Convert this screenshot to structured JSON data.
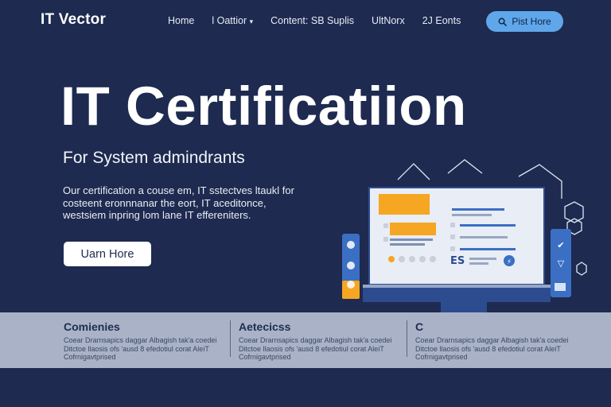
{
  "nav": {
    "brand": "IT Vector",
    "links": [
      "Home",
      "l Oattior",
      "Content: SB Suplis",
      "UltNorx",
      "2J Eonts"
    ],
    "cta_label": "Pist Hore",
    "cta_icon": "search-icon"
  },
  "hero": {
    "title": "IT Certificatiion",
    "subtitle": "For System admindrants",
    "description": "Our certification a couse em, IT sstectves ltaukl for costeent eronnnanar the eort, IT aceditonce, westsiem inpring lom lane IT effereniters.",
    "cta_label": "Uarn Hore"
  },
  "illustration": {
    "screen_label": "ES"
  },
  "columns": [
    {
      "title": "Comienies",
      "body": "Coear Drarnsapics daggar Albagish tak'a coedei Ditctoe llaosis ofs 'ausd 8 efedotiul corat AleiT Cofrnigavtprised"
    },
    {
      "title": "Aetecicss",
      "body": "Coear Drarnsapics daggar Albagish tak'a coedei Ditctoe llaosis ofs 'ausd 8 efedotiul corat AleiT Cofrnigavtprised"
    },
    {
      "title": "C",
      "body": "Coear Drarnsapics daggar Albagish tak'a coedei Ditctoe llaosis ofs 'ausd 8 efedotiul corat AleiT Cofrnigavtprised"
    }
  ],
  "colors": {
    "background": "#1e2a4f",
    "band": "#a9b2c7",
    "accent_blue": "#5fa7ea",
    "accent_orange": "#f5a623"
  }
}
